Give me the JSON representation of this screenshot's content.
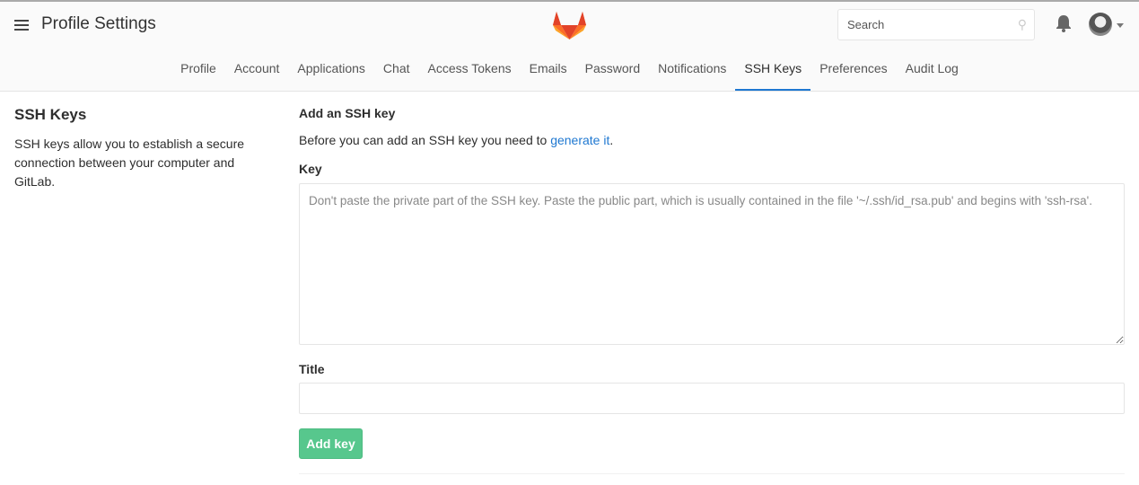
{
  "header": {
    "title": "Profile Settings",
    "search_placeholder": "Search"
  },
  "tabs": [
    "Profile",
    "Account",
    "Applications",
    "Chat",
    "Access Tokens",
    "Emails",
    "Password",
    "Notifications",
    "SSH Keys",
    "Preferences",
    "Audit Log"
  ],
  "active_tab": "SSH Keys",
  "sidebar": {
    "title": "SSH Keys",
    "description": "SSH keys allow you to establish a secure connection between your computer and GitLab."
  },
  "form": {
    "heading": "Add an SSH key",
    "intro_prefix": "Before you can add an SSH key you need to ",
    "intro_link": "generate it",
    "intro_suffix": ".",
    "key_label": "Key",
    "key_placeholder": "Don't paste the private part of the SSH key. Paste the public part, which is usually contained in the file '~/.ssh/id_rsa.pub' and begins with 'ssh-rsa'.",
    "title_label": "Title",
    "title_value": "",
    "submit": "Add key"
  },
  "colors": {
    "accent": "#1f78d1",
    "success": "#57c78d"
  }
}
